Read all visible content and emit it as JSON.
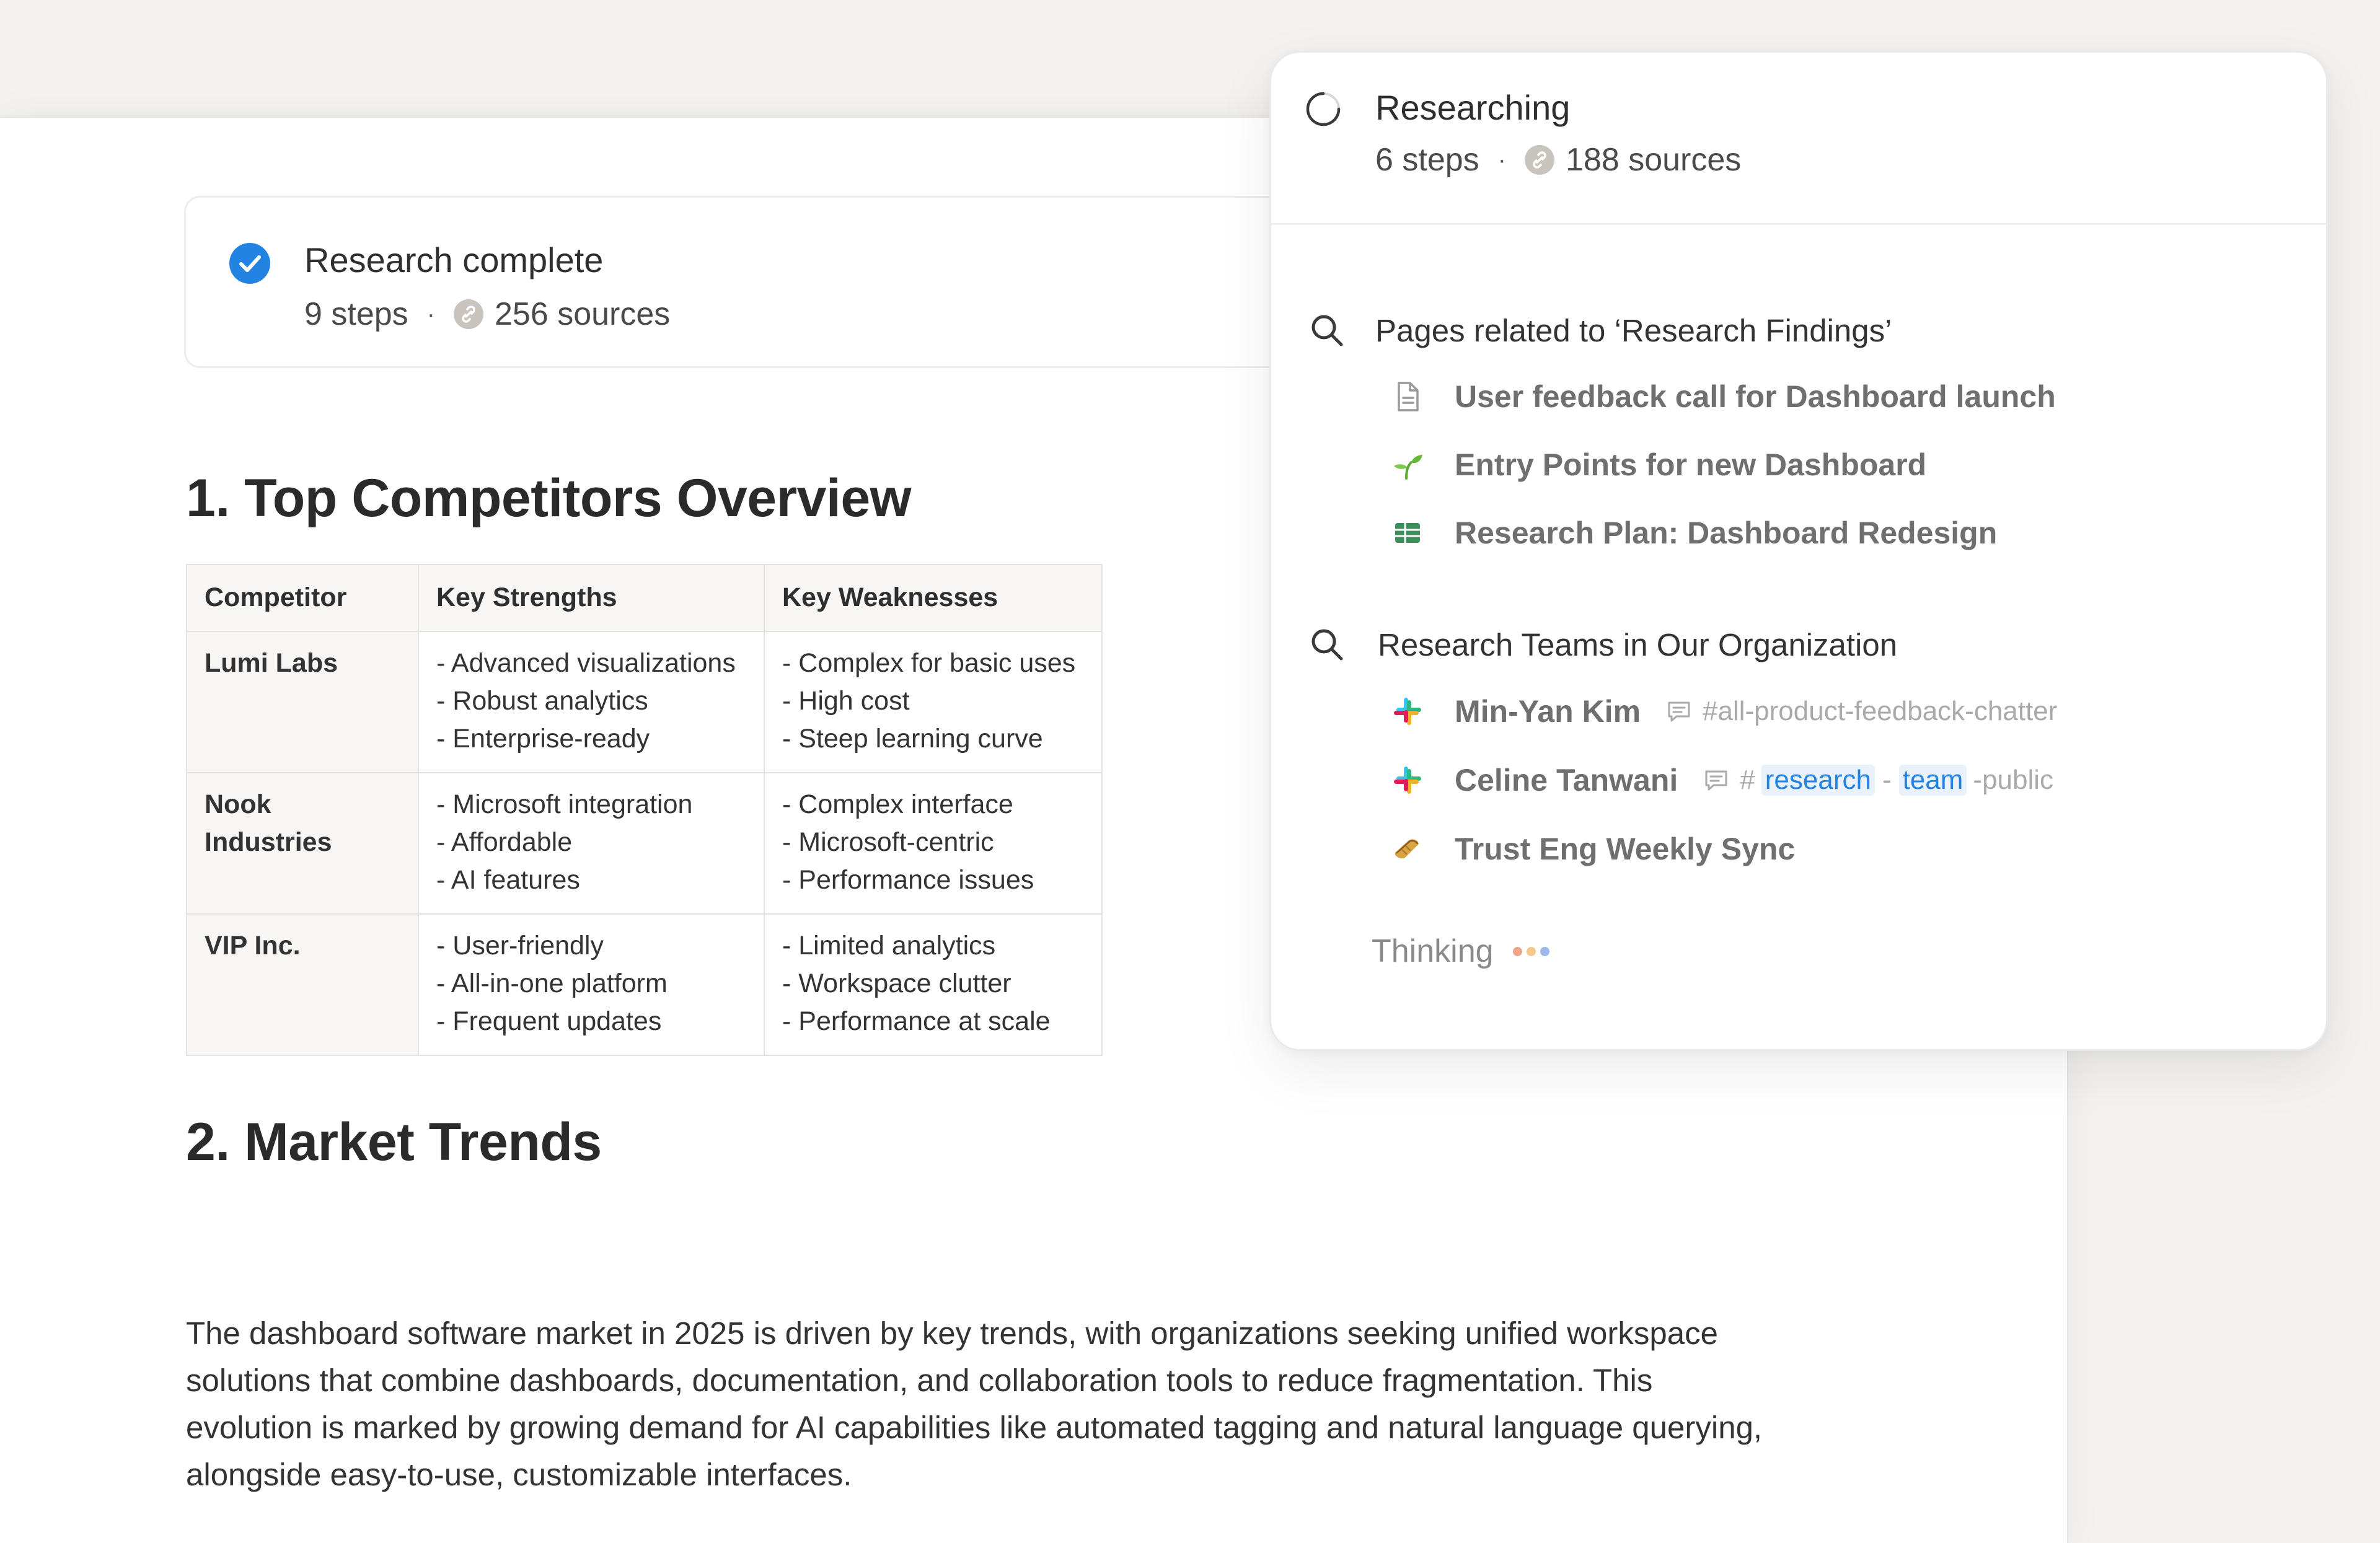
{
  "research_card": {
    "title": "Research complete",
    "steps": "9 steps",
    "separator": "·",
    "sources": "256 sources"
  },
  "section1": {
    "heading": "1. Top Competitors Overview",
    "table": {
      "headers": [
        "Competitor",
        "Key Strengths",
        "Key Weaknesses"
      ],
      "rows": [
        {
          "name": "Lumi Labs",
          "strengths": [
            "- Advanced visualizations",
            "- Robust analytics",
            "- Enterprise-ready"
          ],
          "weaknesses": [
            "- Complex for basic uses",
            "- High cost",
            "- Steep learning curve"
          ]
        },
        {
          "name": "Nook Industries",
          "strengths": [
            "- Microsoft integration",
            "- Affordable",
            "- AI features"
          ],
          "weaknesses": [
            "- Complex interface",
            "- Microsoft-centric",
            "- Performance issues"
          ]
        },
        {
          "name": "VIP Inc.",
          "strengths": [
            "- User-friendly",
            "- All-in-one platform",
            "- Frequent updates"
          ],
          "weaknesses": [
            "- Limited analytics",
            "- Workspace clutter",
            "- Performance at scale"
          ]
        }
      ]
    }
  },
  "section2": {
    "heading": "2. Market Trends",
    "paragraph": "The dashboard software market in 2025 is driven by key trends, with organizations seeking unified workspace solutions that combine dashboards, documentation, and collaboration tools to reduce fragmentation. This evolution is marked by growing demand for AI capabilities like automated tagging and natural language querying, alongside easy-to-use, customizable interfaces."
  },
  "panel": {
    "title": "Researching",
    "steps": "6 steps",
    "separator": "·",
    "sources": "188 sources",
    "query1": {
      "text": "Pages related to ‘Research Findings’",
      "results": [
        {
          "icon": "document-icon",
          "label": "User feedback call for Dashboard launch"
        },
        {
          "icon": "sprout-icon",
          "label": "Entry Points for new Dashboard"
        },
        {
          "icon": "table-icon",
          "label": "Research Plan: Dashboard Redesign"
        }
      ]
    },
    "query2": {
      "text": "Research Teams in Our Organization",
      "results": [
        {
          "icon": "slack-icon",
          "label": "Min-Yan Kim",
          "channel": "#all-product-feedback-chatter"
        },
        {
          "icon": "slack-icon",
          "label": "Celine Tanwani",
          "channel_hash": "#",
          "channel_part1": "research",
          "channel_dash": "-",
          "channel_part2": "team",
          "channel_rest": "-public"
        },
        {
          "icon": "bread-icon",
          "label": "Trust Eng Weekly Sync"
        }
      ]
    },
    "thinking": "Thinking",
    "thinking_dot_colors": [
      "#f2a489",
      "#f5c98a",
      "#9cb8e8"
    ]
  },
  "colors": {
    "accent": "#2383e2",
    "page_background": "#f3f2f1"
  }
}
